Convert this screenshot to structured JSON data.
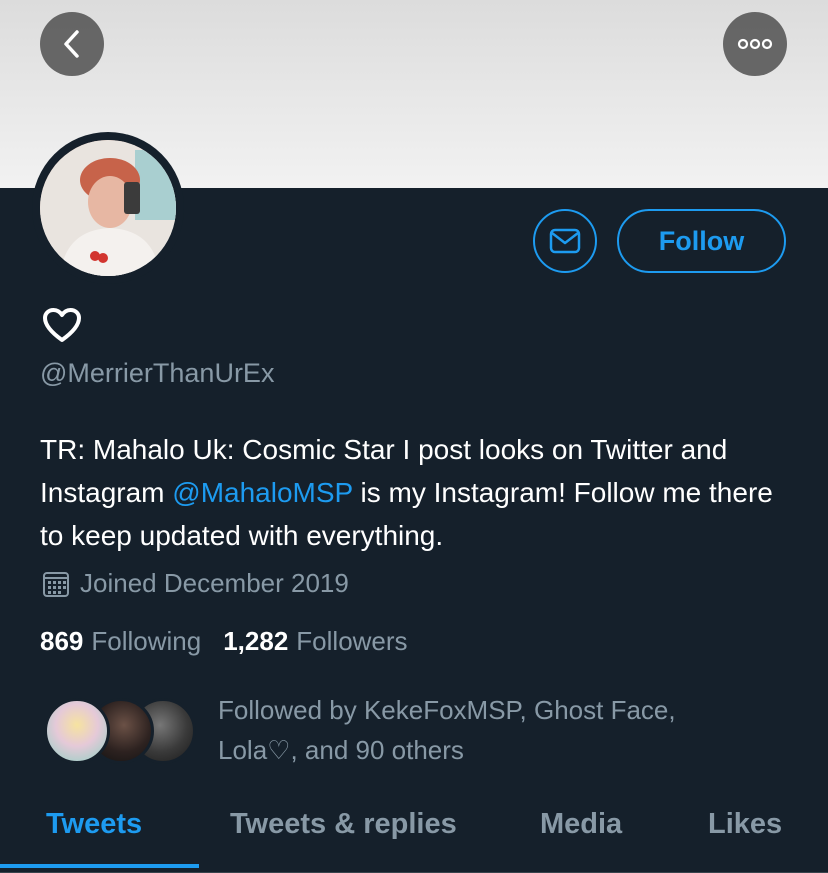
{
  "header": {
    "back_icon": "chevron-left-icon",
    "more_icon": "more-horizontal-icon"
  },
  "profile": {
    "display_name_icon": "heart-outline-icon",
    "handle": "@MerrierThanUrEx",
    "bio_part1": "TR: Mahalo Uk: Cosmic Star I post looks on Twitter and Instagram ",
    "bio_mention": "@MahaloMSP",
    "bio_part2": " is my Instagram! Follow me there to keep updated with everything.",
    "joined": "Joined December 2019",
    "following_count": "869",
    "following_label": "Following",
    "followers_count": "1,282",
    "followers_label": "Followers",
    "followed_by_line1": "Followed by KekeFoxMSP, Ghost Face,",
    "followed_by_line2": "Lola♡, and 90 others"
  },
  "actions": {
    "message_icon": "mail-icon",
    "follow_label": "Follow"
  },
  "tabs": [
    {
      "label": "Tweets",
      "active": true
    },
    {
      "label": "Tweets & replies",
      "active": false
    },
    {
      "label": "Media",
      "active": false
    },
    {
      "label": "Likes",
      "active": false
    }
  ],
  "colors": {
    "background": "#15202b",
    "accent": "#1d9bf0",
    "secondary_text": "#8899a6"
  }
}
